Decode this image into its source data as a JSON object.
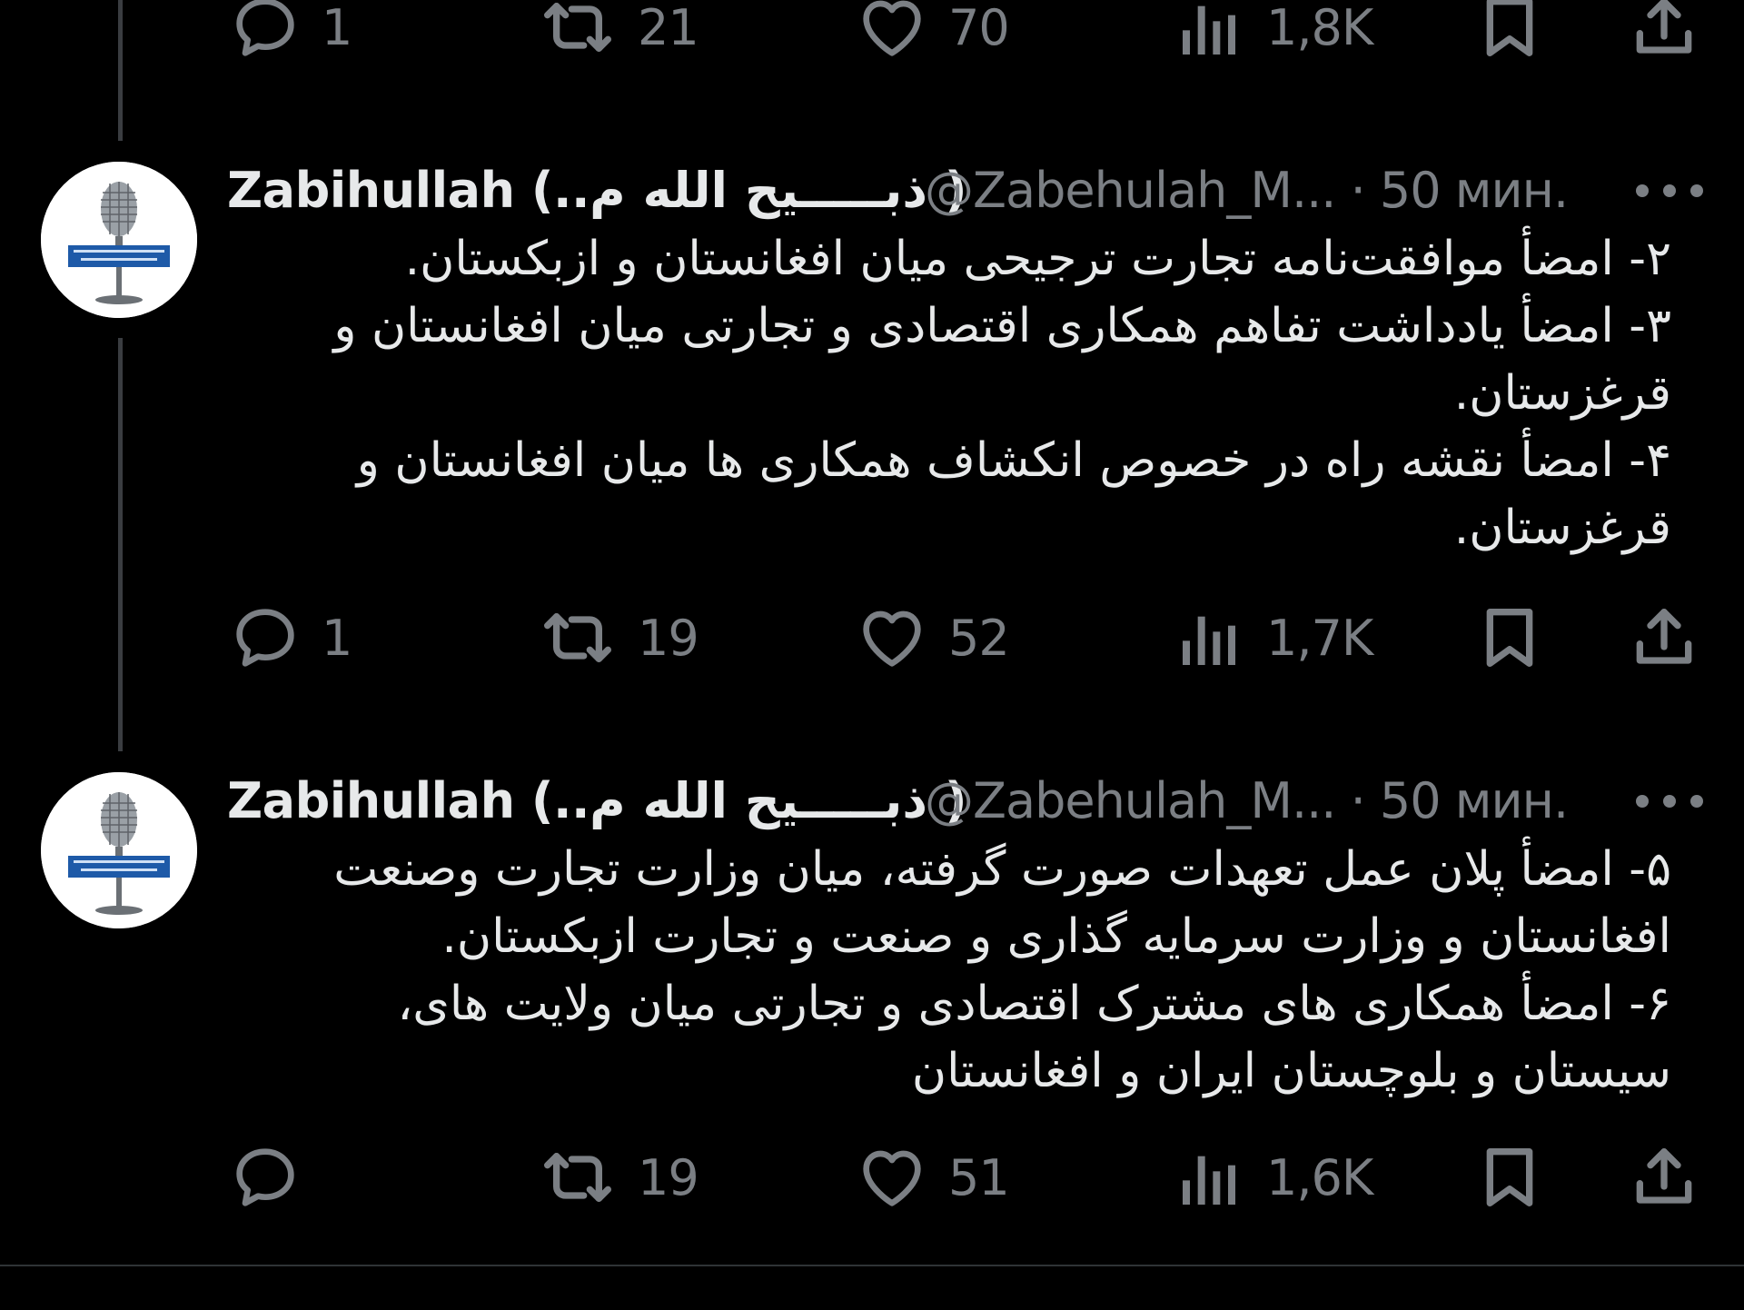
{
  "top_actions": {
    "replies": "1",
    "reposts": "21",
    "likes": "70",
    "views": "1,8K"
  },
  "tweets": [
    {
      "display_name": "Zabihullah (..ذبـــــیح الله م )",
      "handle_time": "@Zabehulah_M... · 50 мин.",
      "text": "۲- امضأ موافقت‌نامه تجارت ترجیحی میان افغانستان و  ازبکستان.\n۳- امضأ یادداشت تفاهم همکاری اقتصادی و تجارتی میان  افغانستان و قرغزستان.\n۴- امضأ نقشه راه در خصوص انکشاف همکاری ها میان افغانستان و قرغزستان.",
      "actions": {
        "replies": "1",
        "reposts": "19",
        "likes": "52",
        "views": "1,7K"
      }
    },
    {
      "display_name": "Zabihullah (..ذبـــــیح الله م )",
      "handle_time": "@Zabehulah_M... · 50 мин.",
      "text": "۵- امضأ پلان عمل تعهدات صورت گرفته، میان وزارت تجارت وصنعت افغانستان و وزارت سرمایه گذاری و صنعت و تجارت ازبکستان.\n۶- امضأ همکاری های مشترک اقتصادی و تجارتی میان ولایت های، سیستان و بلوچستان ایران و افغانستان",
      "actions": {
        "replies": "",
        "reposts": "19",
        "likes": "51",
        "views": "1,6K"
      }
    }
  ],
  "colors": {
    "background": "#000000",
    "text_primary": "#e7e9ea",
    "text_secondary": "#7b7f84",
    "thread_line": "#3a3d41"
  }
}
